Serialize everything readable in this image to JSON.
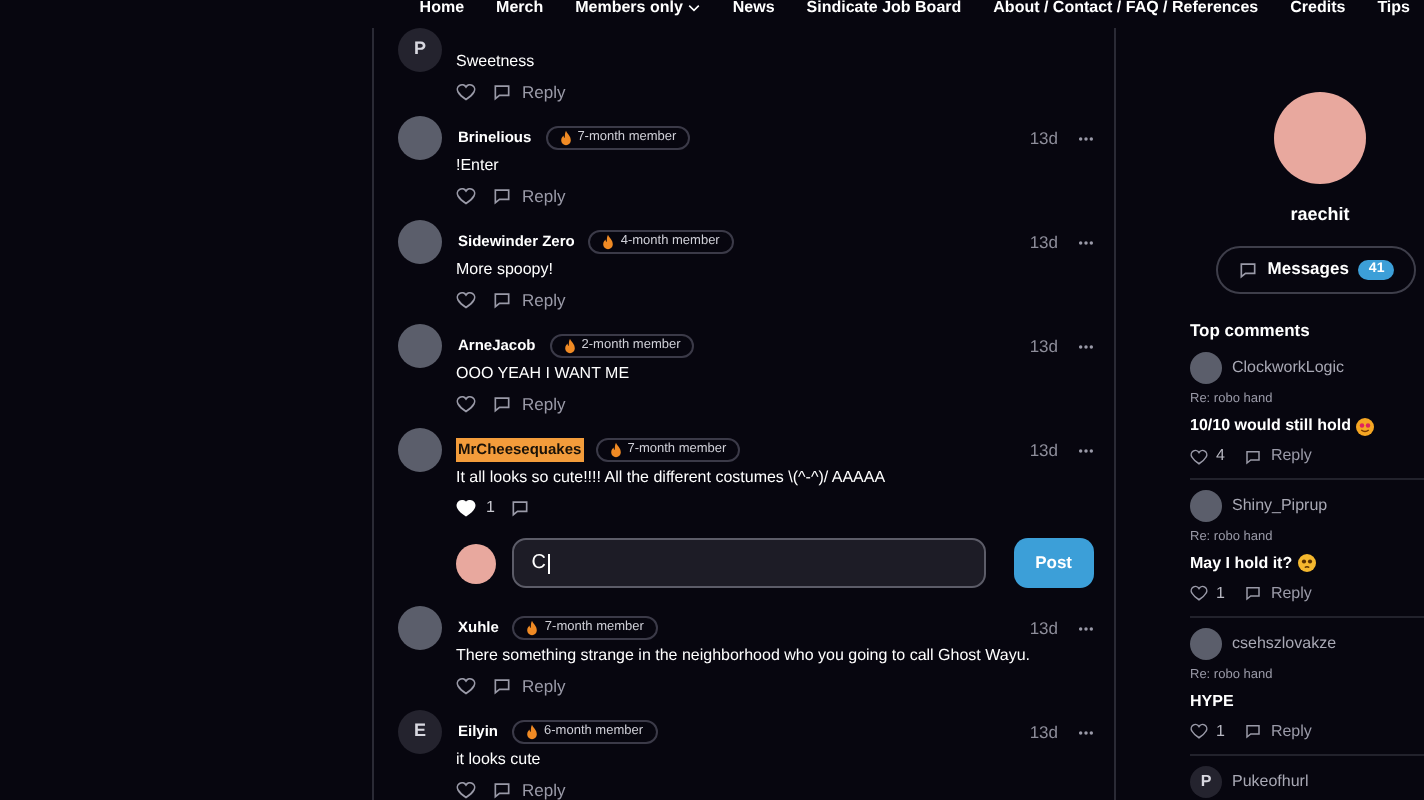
{
  "nav": [
    {
      "label": "Home",
      "dropdown": false
    },
    {
      "label": "Merch",
      "dropdown": false
    },
    {
      "label": "Members only",
      "dropdown": true
    },
    {
      "label": "News",
      "dropdown": false
    },
    {
      "label": "Sindicate Job Board",
      "dropdown": false
    },
    {
      "label": "About / Contact / FAQ / References",
      "dropdown": false
    },
    {
      "label": "Credits",
      "dropdown": false
    },
    {
      "label": "Tips",
      "dropdown": false
    }
  ],
  "comments": [
    {
      "avatar_letter": "P",
      "text": "Sweetness",
      "liked": false,
      "reply_label": "Reply"
    },
    {
      "author": "Brinelious",
      "badge": "7-month member",
      "time": "13d",
      "text": "!Enter",
      "liked": false,
      "reply_label": "Reply"
    },
    {
      "author": "Sidewinder Zero",
      "badge": "4-month member",
      "time": "13d",
      "text": "More spoopy!",
      "liked": false,
      "reply_label": "Reply"
    },
    {
      "author": "ArneJacob",
      "badge": "2-month member",
      "time": "13d",
      "text": "OOO YEAH I WANT ME",
      "liked": false,
      "reply_label": "Reply"
    },
    {
      "author": "MrCheesequakes",
      "author_highlighted": true,
      "badge": "7-month member",
      "time": "13d",
      "text": "It all looks so cute!!!! All the different costumes \\(^-^)/ AAAAA",
      "liked": true,
      "likes": "1",
      "reply_box": {
        "value": "C",
        "button": "Post"
      }
    },
    {
      "author": "Xuhle",
      "badge": "7-month member",
      "time": "13d",
      "text": "There something strange in the neighborhood who you going to call Ghost Wayu.",
      "liked": false,
      "reply_label": "Reply"
    },
    {
      "author": "Eilyin",
      "avatar_letter": "E",
      "badge": "6-month member",
      "time": "13d",
      "text": "it looks cute",
      "liked": false,
      "reply_label": "Reply"
    }
  ],
  "profile": {
    "username": "raechit",
    "messages_label": "Messages",
    "messages_count": "41"
  },
  "top_comments": {
    "title": "Top comments",
    "items": [
      {
        "author": "ClockworkLogic",
        "context": "Re: robo hand",
        "kind": "adoring",
        "text": "10/10 would still hold",
        "likes": "4",
        "reply_label": "Reply"
      },
      {
        "author": "Shiny_Piprup",
        "context": "Re: robo hand",
        "kind": "pleading",
        "text": "May I hold it?",
        "likes": "1",
        "reply_label": "Reply"
      },
      {
        "author": "csehszlovakze",
        "kind": "plain",
        "context": "Re: robo hand",
        "text": "HYPE",
        "likes": "1",
        "reply_label": "Reply"
      },
      {
        "author": "Pukeofhurl",
        "avatar_letter": "P"
      }
    ]
  }
}
